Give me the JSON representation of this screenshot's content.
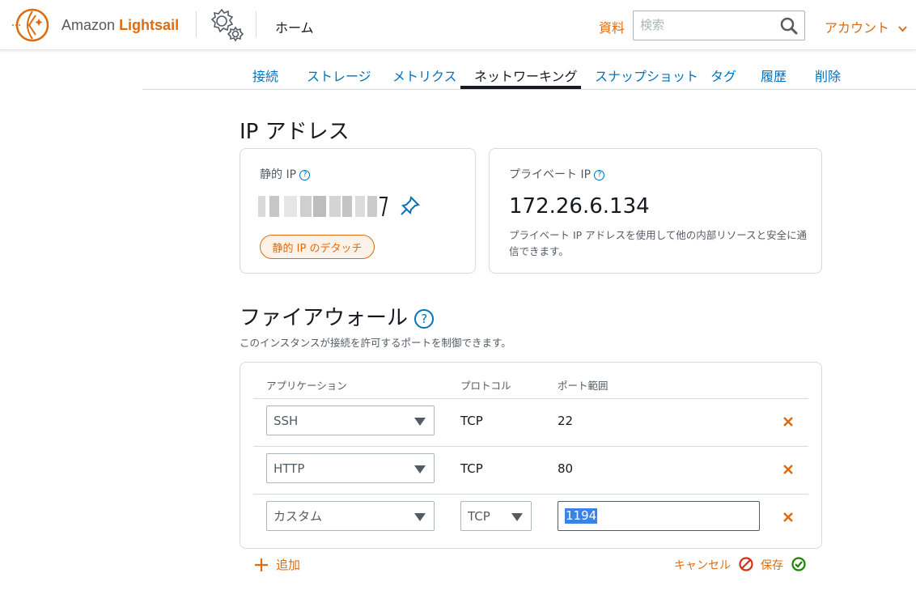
{
  "header": {
    "brand_plain": "Amazon",
    "brand_bold": "Lightsail",
    "home": "ホーム",
    "docs": "資料",
    "search_placeholder": "検索",
    "account": "アカウント"
  },
  "tabs": [
    {
      "label": "接続"
    },
    {
      "label": "ストレージ"
    },
    {
      "label": "メトリクス"
    },
    {
      "label": "ネットワーキング",
      "active": true
    },
    {
      "label": "スナップショット"
    },
    {
      "label": "タグ"
    },
    {
      "label": "履歴"
    },
    {
      "label": "削除"
    }
  ],
  "ip_section": {
    "title": "IP アドレス",
    "static_ip": {
      "label": "静的 IP",
      "help": "?",
      "detach_button": "静的 IP のデタッチ"
    },
    "private_ip": {
      "label": "プライベート IP",
      "help": "?",
      "value": "172.26.6.134",
      "description": "プライベート IP アドレスを使用して他の内部リソースと安全に通信できます。"
    }
  },
  "firewall": {
    "title": "ファイアウォール",
    "help": "?",
    "description": "このインスタンスが接続を許可するポートを制御できます。",
    "columns": {
      "application": "アプリケーション",
      "protocol": "プロトコル",
      "port_range": "ポート範囲"
    },
    "rules": [
      {
        "application": "SSH",
        "protocol": "TCP",
        "port": "22"
      },
      {
        "application": "HTTP",
        "protocol": "TCP",
        "port": "80"
      },
      {
        "application": "カスタム",
        "protocol": "TCP",
        "port": "1194"
      }
    ],
    "add_label": "追加",
    "cancel_label": "キャンセル",
    "save_label": "保存"
  },
  "colors": {
    "accent": "#dd6b10",
    "link": "#0073bb",
    "text": "#16191f",
    "muted": "#545b64",
    "border": "#d5dbdb",
    "cancel_icon": "#d13212",
    "save_icon": "#1d8102"
  }
}
